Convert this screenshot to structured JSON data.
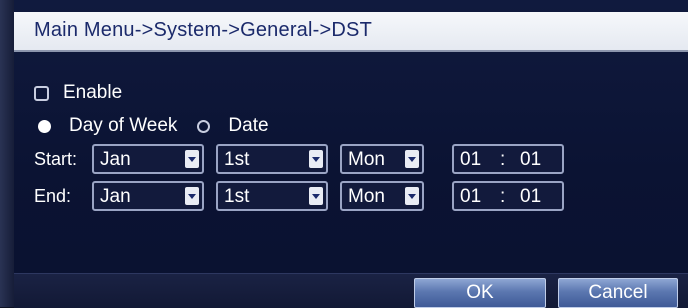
{
  "title": "Main Menu->System->General->DST",
  "enable": {
    "label": "Enable",
    "checked": false
  },
  "mode": {
    "options": [
      "Day of Week",
      "Date"
    ],
    "selected": "Day of Week"
  },
  "start": {
    "label": "Start:",
    "month": "Jan",
    "week": "1st",
    "day": "Mon",
    "hour": "01",
    "separator": ":",
    "minute": "01"
  },
  "end": {
    "label": "End:",
    "month": "Jan",
    "week": "1st",
    "day": "Mon",
    "hour": "01",
    "separator": ":",
    "minute": "01"
  },
  "buttons": {
    "ok": "OK",
    "cancel": "Cancel"
  },
  "colors": {
    "title_text": "#1b2a6b",
    "background": "#0b1333",
    "button": "#5b77b0"
  },
  "icons": {
    "dropdown": "chevron-down-icon",
    "checkbox": "checkbox-icon",
    "radio": "radio-icon"
  }
}
